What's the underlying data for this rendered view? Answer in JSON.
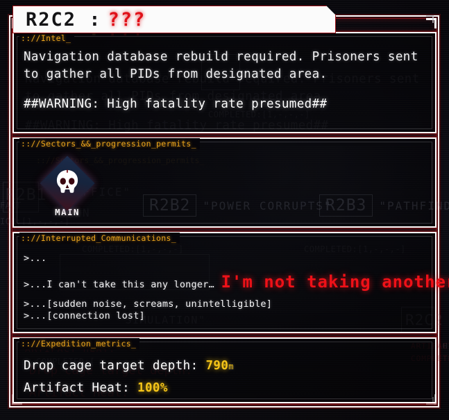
{
  "window": {
    "title_main": "R2C2 :",
    "title_accent": "???"
  },
  "panels": {
    "intel": {
      "label": ":://Intel_",
      "lines": [
        "Navigation database rebuild required. Prisoners sent",
        "to gather all PIDs from designated area."
      ],
      "warning": "##WARNING: High fatality rate presumed##"
    },
    "sectors": {
      "label": ":://Sectors_&&_progression_permits_",
      "active_node": {
        "icon": "skull-icon",
        "label": "MAIN"
      },
      "ghost_sectors": [
        {
          "code": "R2B1",
          "quote": "\"OFFICE\""
        },
        {
          "code": "R2B2",
          "quote": "\"POWER CORRUPTS\""
        },
        {
          "code": "R2B3",
          "quote": "\"PATHFINDER\""
        }
      ]
    },
    "comms": {
      "label": ":://Interrupted_Communications_",
      "lines": [
        {
          "prefix": ">...",
          "text": "",
          "style": "normal"
        },
        {
          "prefix": ">...",
          "text": "I can't take this any longer…",
          "shout": "I'm not taking another step. NOT ONE-",
          "style": "mixed"
        },
        {
          "prefix": ">...",
          "text": "[sudden noise, screams, unintelligible]",
          "style": "normal"
        },
        {
          "prefix": ">...",
          "text": "[connection lost]",
          "style": "normal"
        }
      ]
    },
    "metrics": {
      "label": ":://Expedition_metrics_",
      "rows": [
        {
          "label": "Drop cage target depth:",
          "value": "790",
          "unit": "m"
        },
        {
          "label": "Artifact Heat:",
          "value": "100%",
          "unit": ""
        }
      ]
    }
  },
  "ghost_text": {
    "title_main": "R2C2 :",
    "title_accent": "???",
    "intel_line1": "Navigation database rebuild required. Prisoners sent",
    "intel_line2": "to gather all PIDs from designated area.",
    "intel_warning": "##WARNING: High fatality rate presumed##",
    "sectors_label": ":://Sectors_&&_progression_permits_",
    "completed_left": "COMPLETED:[1,-,-,-]",
    "completed_right": "COMPLETED:[1,-,-,-]",
    "main_label": "MAIN",
    "office_quote": "\"OFFICE\"",
    "r2b1": "R2B1",
    "r2b2": "R2B2",
    "r2b3": "R2B3",
    "power_corrupts": "\"POWER CORRUPTS\"",
    "pathfinder": "\"PATHFINDER\"",
    "r2c2_chip": "R2C2",
    "artifact_heat": "ARTIFACT HEAT:",
    "artifact_heat_right": "ARTIFACT",
    "completed_metrics": "COMPLETED:[",
    "simulation_quote": "\"SIMULATION\"",
    "fact_frag": "FACT",
    "ion_frag": "ION:[1,-,-,-]",
    "h_frag": "H"
  },
  "colors": {
    "accent_amber": "#e8a21c",
    "accent_red": "#ee1118",
    "metric_yellow": "#f5c518",
    "frame_white": "#ffffff",
    "frame_red": "#96141a",
    "bg": "#08070a"
  }
}
